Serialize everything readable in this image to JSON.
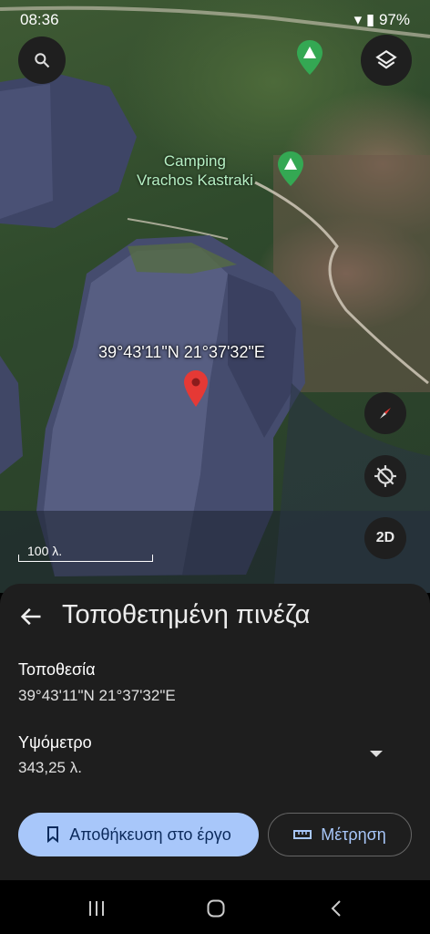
{
  "status_bar": {
    "time": "08:36",
    "battery": "97%"
  },
  "map": {
    "place_label": "Camping\nVrachos Kastraki",
    "coordinates_label": "39°43'11\"N 21°37'32\"E",
    "scale_label": "100 λ.",
    "mode_button": "2D"
  },
  "sheet": {
    "title": "Τοποθετημένη πινέζα",
    "location_label": "Τοποθεσία",
    "location_value": "39°43'11\"N 21°37'32\"E",
    "elevation_label": "Υψόμετρο",
    "elevation_value": "343,25 λ.",
    "save_button": "Αποθήκευση στο έργο",
    "measure_button": "Μέτρηση"
  },
  "colors": {
    "accent": "#a8c7fa",
    "pin": "#e53935",
    "camp_marker": "#34a853"
  },
  "icons": [
    "search-icon",
    "layers-icon",
    "camp-marker-icon",
    "pin-icon",
    "compass-icon",
    "location-off-icon",
    "back-arrow-icon",
    "bookmark-icon",
    "ruler-icon",
    "chevron-down-icon"
  ]
}
